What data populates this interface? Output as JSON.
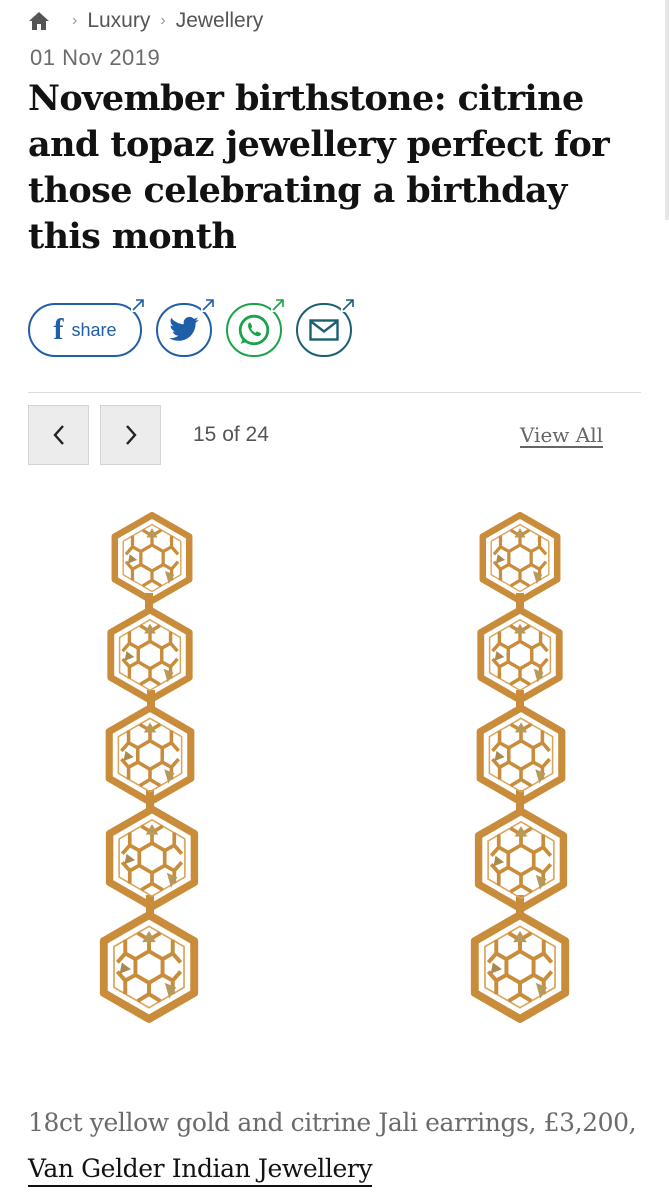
{
  "breadcrumb": {
    "home_icon": "home-icon",
    "items": [
      "Luxury",
      "Jewellery"
    ]
  },
  "article": {
    "date": "01 Nov 2019",
    "headline": "November birthstone: citrine and topaz jewellery perfect for those celebrating a birthday this month"
  },
  "share": {
    "facebook_label": "share",
    "icons": [
      "facebook-icon",
      "twitter-icon",
      "whatsapp-icon",
      "email-icon"
    ],
    "colors": {
      "facebook": "#1f5fa8",
      "twitter": "#1f5fa8",
      "whatsapp": "#1aa34a",
      "email": "#1a5f73"
    }
  },
  "gallery": {
    "counter": "15 of 24",
    "current": 15,
    "total": 24,
    "view_all_label": "View All"
  },
  "image": {
    "subject": "pair of hexagonal gold drop earrings",
    "colors": {
      "gold": "#c98c3a",
      "citrine": "#b79a5a"
    }
  },
  "caption": {
    "text": "18ct yellow gold and citrine Jali earrings, £3,200,",
    "link": "Van Gelder Indian Jewellery"
  }
}
